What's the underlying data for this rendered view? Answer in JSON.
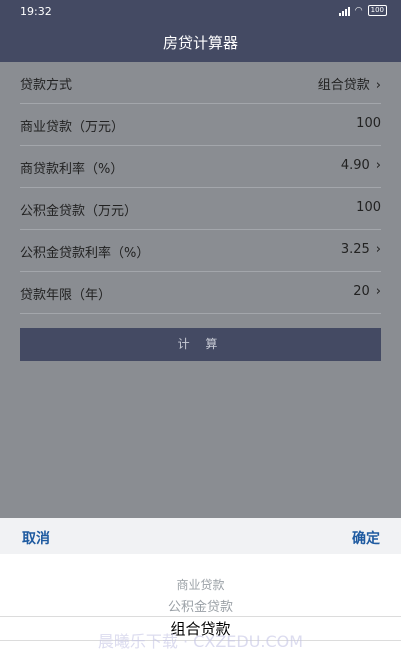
{
  "status": {
    "time": "19:32",
    "battery": "100"
  },
  "title": "房贷计算器",
  "rows": [
    {
      "label": "贷款方式",
      "value": "组合贷款",
      "arrow": true
    },
    {
      "label": "商业贷款（万元）",
      "value": "100",
      "arrow": false
    },
    {
      "label": "商贷款利率（%）",
      "value": "4.90",
      "arrow": true
    },
    {
      "label": "公积金贷款（万元）",
      "value": "100",
      "arrow": false
    },
    {
      "label": "公积金贷款利率（%）",
      "value": "3.25",
      "arrow": true
    },
    {
      "label": "贷款年限（年）",
      "value": "20",
      "arrow": true
    }
  ],
  "calc_label": "计 算",
  "sheet": {
    "cancel": "取消",
    "confirm": "确定",
    "options": [
      "商业贷款",
      "公积金贷款",
      "组合贷款"
    ]
  },
  "watermark": "晨曦乐下载 · CXZEDU.COM"
}
